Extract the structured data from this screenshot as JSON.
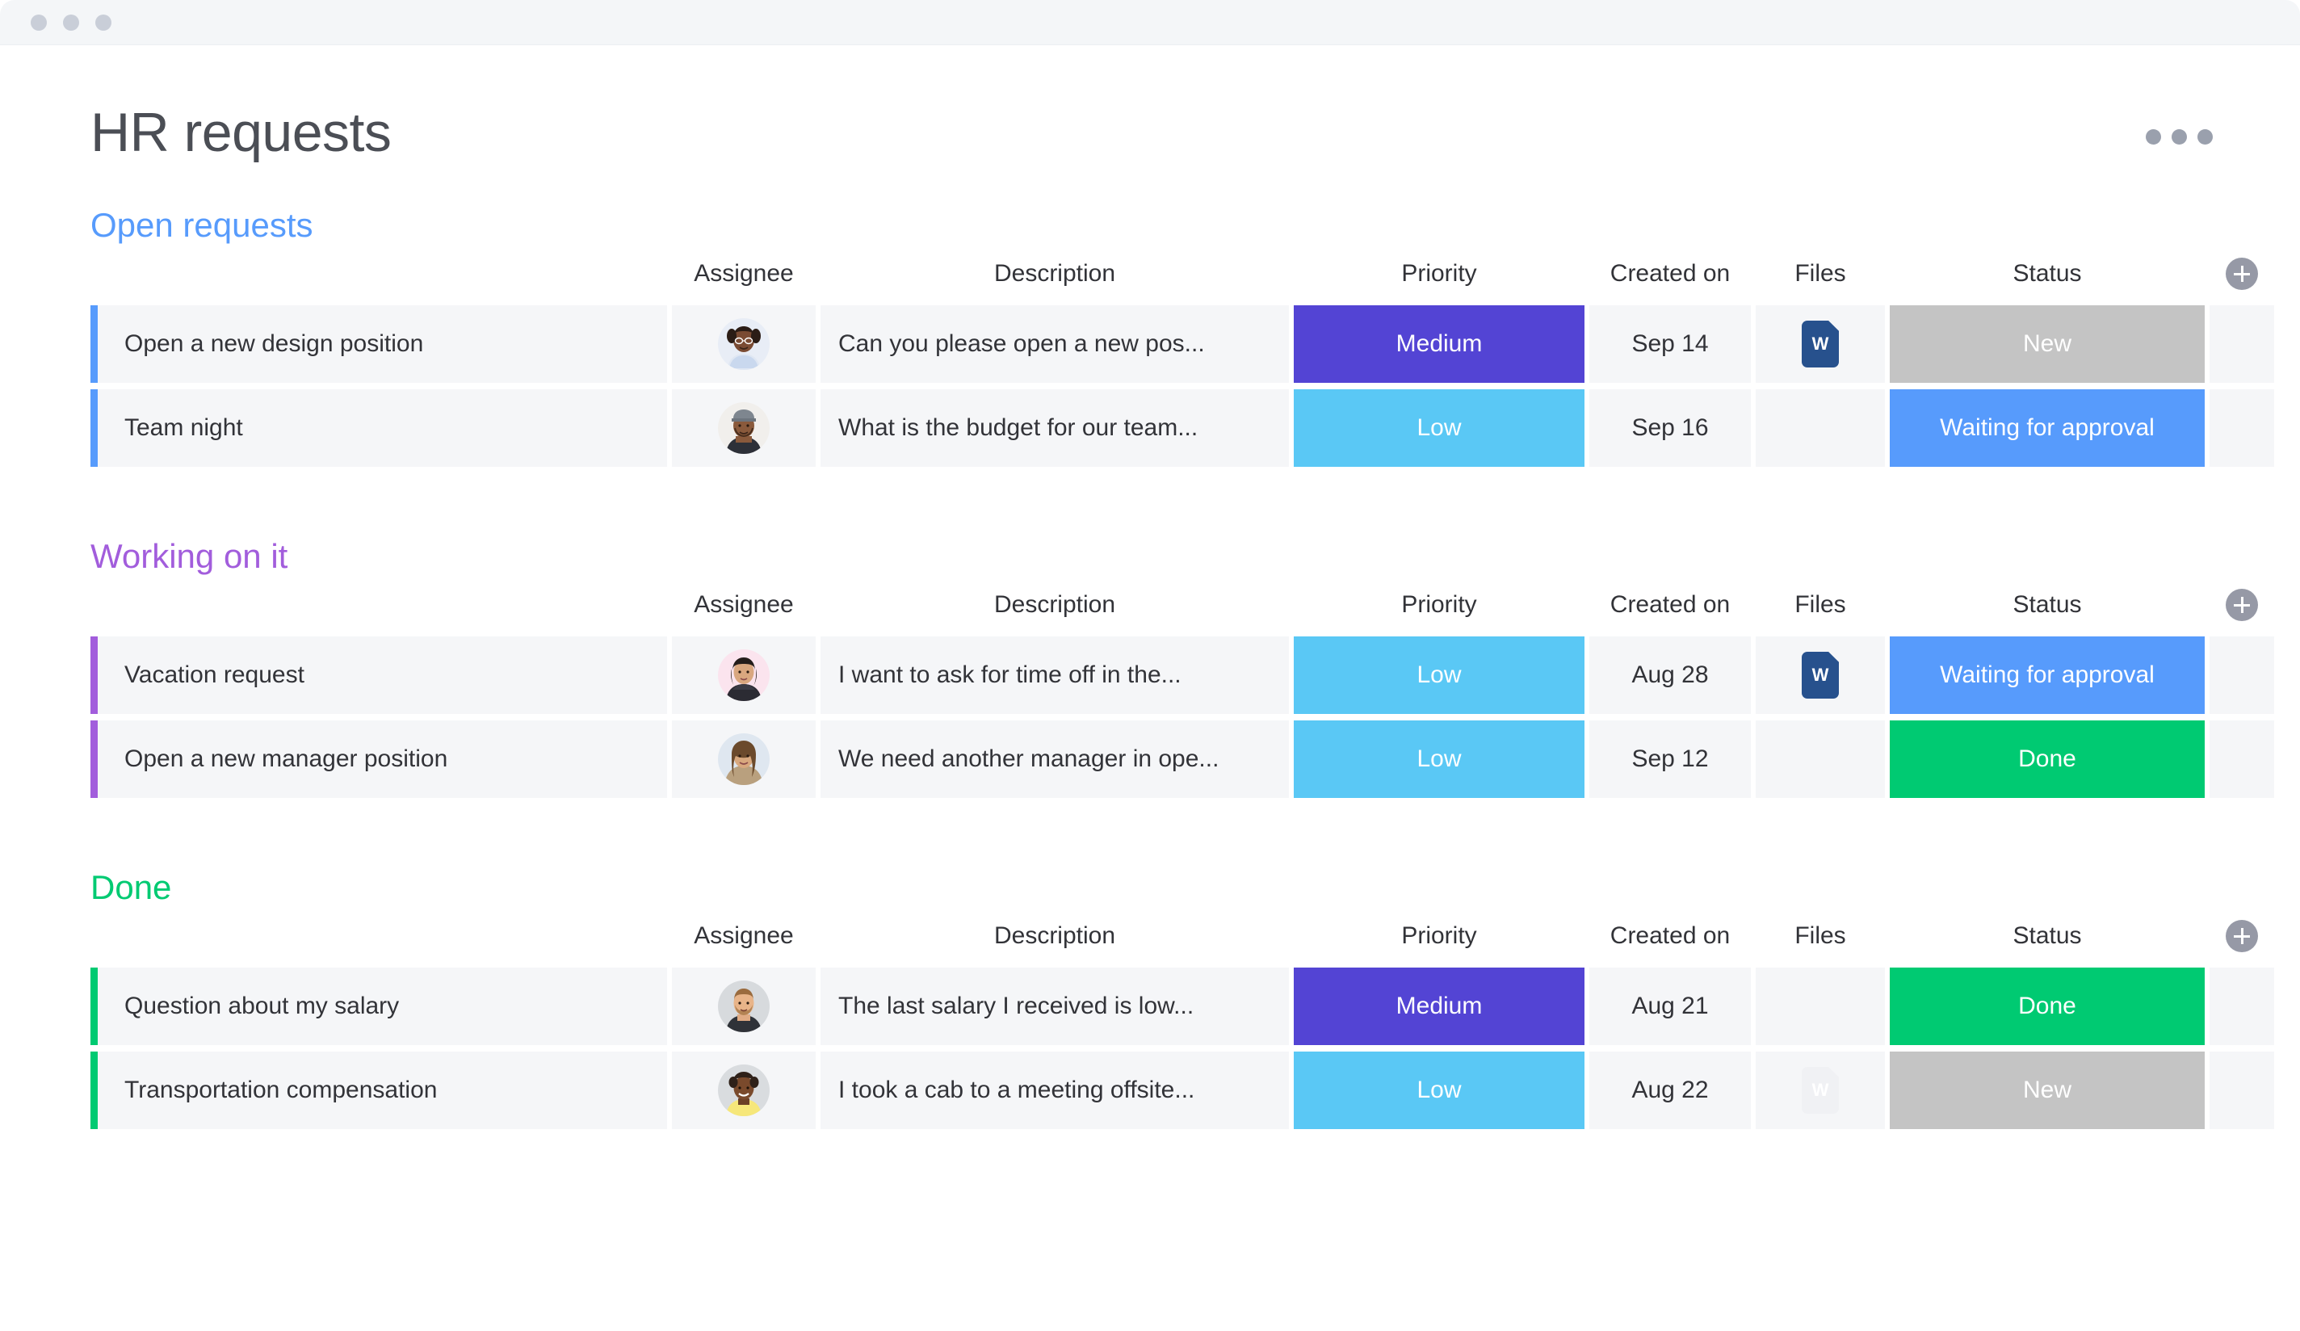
{
  "window": {
    "traffic_lights": [
      "close",
      "minimize",
      "zoom"
    ]
  },
  "header": {
    "title": "HR requests",
    "menu_icon": "more-horizontal-icon"
  },
  "columns": [
    "",
    "Assignee",
    "Description",
    "Priority",
    "Created on",
    "Files",
    "Status"
  ],
  "add_column_label": "+",
  "colors": {
    "open_requests": "#579bfc",
    "working_on_it": "#a25ddc",
    "done": "#00ca72",
    "priority_medium": "#5344d4",
    "priority_low": "#5ac8f5",
    "status_new": "#c4c4c4",
    "status_waiting": "#579bfc",
    "status_done": "#00ca72",
    "title_text": "#4b4e55",
    "cell_bg": "#f5f6f8"
  },
  "groups": [
    {
      "name": "Open requests",
      "color": "#579bfc",
      "columns": [
        "Assignee",
        "Description",
        "Priority",
        "Created on",
        "Files",
        "Status"
      ],
      "rows": [
        {
          "name": "Open a new design position",
          "assignee": "avatar-woman-glasses",
          "description": "Can you please open a new pos...",
          "priority": "Medium",
          "priority_color": "#5344d4",
          "created_on": "Sep 14",
          "file": "W",
          "file_ghost": false,
          "status": "New",
          "status_color": "#c4c4c4"
        },
        {
          "name": "Team night",
          "assignee": "avatar-man-cap",
          "description": "What is the budget for our team...",
          "priority": "Low",
          "priority_color": "#5ac8f5",
          "created_on": "Sep 16",
          "file": "",
          "file_ghost": false,
          "status": "Waiting for approval",
          "status_color": "#579bfc"
        }
      ]
    },
    {
      "name": "Working on it",
      "color": "#a25ddc",
      "columns": [
        "Assignee",
        "Description",
        "Priority",
        "Created on",
        "Files",
        "Status"
      ],
      "rows": [
        {
          "name": "Vacation request",
          "assignee": "avatar-woman-dark-hair",
          "description": "I want to ask for time off in the...",
          "priority": "Low",
          "priority_color": "#5ac8f5",
          "created_on": "Aug 28",
          "file": "W",
          "file_ghost": false,
          "status": "Waiting for approval",
          "status_color": "#579bfc"
        },
        {
          "name": "Open a new manager position",
          "assignee": "avatar-woman-long-hair",
          "description": "We need another manager in ope...",
          "priority": "Low",
          "priority_color": "#5ac8f5",
          "created_on": "Sep 12",
          "file": "",
          "file_ghost": false,
          "status": "Done",
          "status_color": "#00ca72"
        }
      ]
    },
    {
      "name": "Done",
      "color": "#00ca72",
      "columns": [
        "Assignee",
        "Description",
        "Priority",
        "Created on",
        "Files",
        "Status"
      ],
      "rows": [
        {
          "name": "Question about my salary",
          "assignee": "avatar-man-beard",
          "description": "The last salary I received is low...",
          "priority": "Medium",
          "priority_color": "#5344d4",
          "created_on": "Aug 21",
          "file": "",
          "file_ghost": false,
          "status": "Done",
          "status_color": "#00ca72"
        },
        {
          "name": "Transportation compensation",
          "assignee": "avatar-woman-yellow-top",
          "description": "I took a cab to a meeting offsite...",
          "priority": "Low",
          "priority_color": "#5ac8f5",
          "created_on": "Aug 22",
          "file": "W",
          "file_ghost": true,
          "status": "New",
          "status_color": "#c4c4c4"
        }
      ]
    }
  ]
}
